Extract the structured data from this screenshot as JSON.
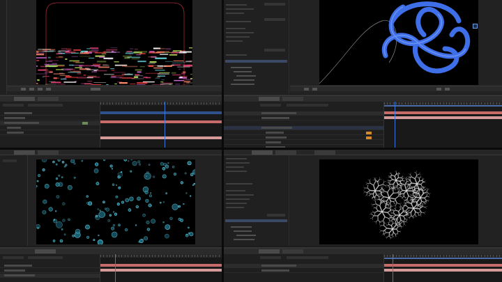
{
  "app": {
    "kind": "motion-graphics-editor-2x2-grid"
  },
  "colors": {
    "bg": "#1c1c1c",
    "panel": "#262626",
    "accent_blue": "#3d78d8",
    "track_red": "#c76a6a",
    "track_pink": "#d49a9a",
    "track_orange": "#d48a2a",
    "track_green": "#6b8c5a",
    "selection": "#3a4a66"
  },
  "tiles": [
    {
      "id": "top-left",
      "viewer": {
        "title": "",
        "subject": "glitch-lines-on-black",
        "magnification": ""
      },
      "timeline": {
        "comp_tab": "",
        "timecode": "",
        "playhead_fraction": 0.53
      }
    },
    {
      "id": "top-right",
      "viewer": {
        "title": "",
        "subject": "blue-tube-loops",
        "magnification": ""
      },
      "effects": {
        "panel_title": ""
      },
      "timeline": {
        "comp_tab": "",
        "timecode": "",
        "playhead_fraction": 0.09
      }
    },
    {
      "id": "bottom-left",
      "viewer": {
        "title": "",
        "subject": "cyan-bubbles",
        "magnification": ""
      },
      "timeline": {
        "comp_tab": "",
        "timecode": "",
        "playhead_fraction": 0.12
      }
    },
    {
      "id": "bottom-right",
      "viewer": {
        "title": "",
        "subject": "white-crystal-fractal",
        "magnification": ""
      },
      "effects": {
        "panel_title": ""
      },
      "timeline": {
        "comp_tab": "",
        "timecode": "",
        "playhead_fraction": 0.07
      }
    }
  ]
}
